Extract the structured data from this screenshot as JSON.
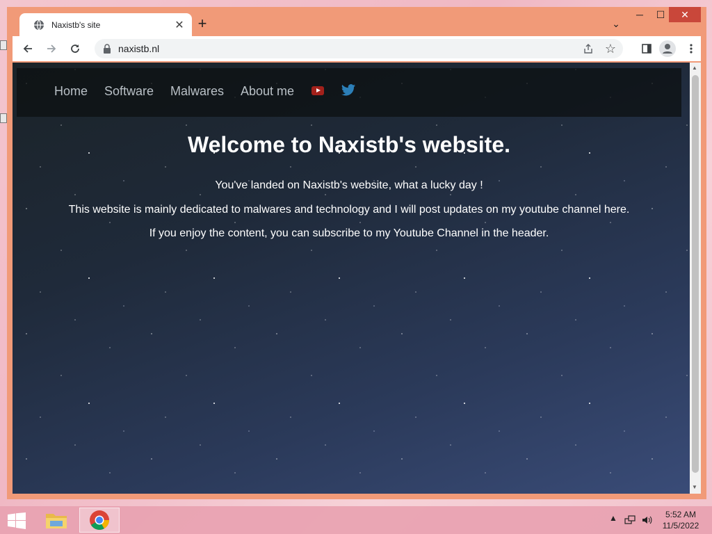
{
  "browser": {
    "tab": {
      "title": "Naxistb's site"
    },
    "address": {
      "url": "naxistb.nl"
    }
  },
  "site": {
    "nav": [
      {
        "label": "Home"
      },
      {
        "label": "Software"
      },
      {
        "label": "Malwares"
      },
      {
        "label": "About me"
      }
    ],
    "hero": {
      "title": "Welcome to Naxistb's website.",
      "lines": [
        "You've landed on Naxistb's website, what a lucky day !",
        "This website is mainly dedicated to malwares and technology and I will post updates on my youtube channel here.",
        "If you enjoy the content, you can subscribe to my Youtube Channel in the header."
      ]
    },
    "icons": {
      "youtube": "youtube-icon",
      "twitter": "twitter-icon"
    }
  },
  "taskbar": {
    "clock": {
      "time": "5:52 AM",
      "date": "11/5/2022"
    }
  },
  "colors": {
    "window_frame": "#f19a78",
    "close_button": "#c9473a",
    "youtube_red": "#a3211b",
    "twitter_blue": "#2c7fb8",
    "hero_text": "#ffffff"
  }
}
